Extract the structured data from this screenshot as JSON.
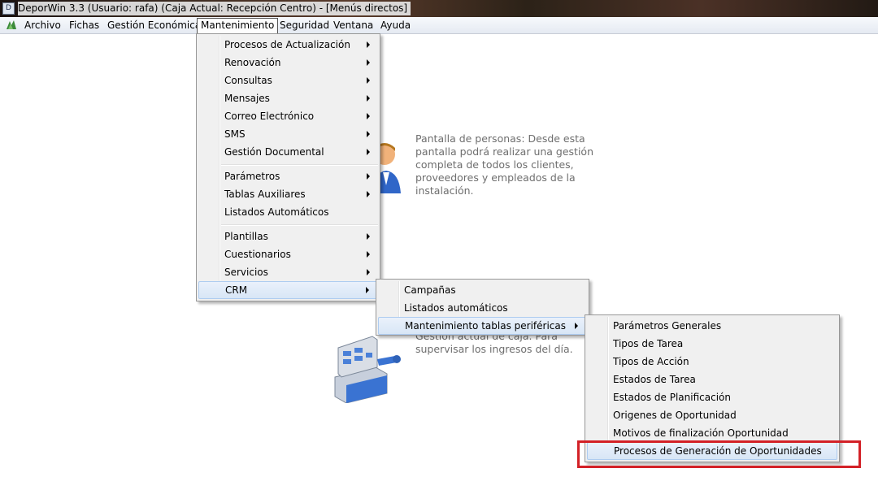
{
  "window": {
    "title": "DeporWin 3.3  (Usuario: rafa)  (Caja Actual: Recepción Centro) - [Menús directos]",
    "app_icon_letter": "D"
  },
  "menubar": {
    "items": [
      "Archivo",
      "Fichas",
      "Gestión Económica",
      "Mantenimiento",
      "Seguridad",
      "Ventana",
      "Ayuda"
    ],
    "active": "Mantenimiento"
  },
  "background": {
    "personas_text": [
      "Pantalla de personas: Desde esta",
      "pantalla podrá realizar una gestión",
      "completa de todos los clientes,",
      "proveedores y empleados de la",
      "instalación."
    ],
    "caja_text": [
      "Gestión actual de caja. Para",
      "supervisar los ingresos del día."
    ]
  },
  "menu_mantenimiento": {
    "group1": [
      {
        "label": "Procesos de Actualización",
        "submenu": true
      },
      {
        "label": "Renovación",
        "submenu": true
      },
      {
        "label": "Consultas",
        "submenu": true
      },
      {
        "label": "Mensajes",
        "submenu": true
      },
      {
        "label": "Correo Electrónico",
        "submenu": true
      },
      {
        "label": "SMS",
        "submenu": true
      },
      {
        "label": "Gestión Documental",
        "submenu": true
      }
    ],
    "group2": [
      {
        "label": "Parámetros",
        "submenu": true
      },
      {
        "label": "Tablas Auxiliares",
        "submenu": true
      },
      {
        "label": "Listados Automáticos",
        "submenu": false
      }
    ],
    "group3": [
      {
        "label": "Plantillas",
        "submenu": true
      },
      {
        "label": "Cuestionarios",
        "submenu": true
      },
      {
        "label": "Servicios",
        "submenu": true
      },
      {
        "label": "CRM",
        "submenu": true,
        "highlighted": true
      }
    ]
  },
  "menu_crm": {
    "items": [
      {
        "label": "Campañas",
        "submenu": false
      },
      {
        "label": "Listados automáticos",
        "submenu": false
      },
      {
        "label": "Mantenimiento tablas periféricas",
        "submenu": true,
        "highlighted": true
      }
    ]
  },
  "menu_tablas": {
    "items": [
      {
        "label": "Parámetros Generales"
      },
      {
        "label": "Tipos de Tarea"
      },
      {
        "label": "Tipos de Acción"
      },
      {
        "label": "Estados de Tarea"
      },
      {
        "label": "Estados de Planificación"
      },
      {
        "label": "Origenes de Oportunidad"
      },
      {
        "label": "Motivos de finalización Oportunidad"
      },
      {
        "label": "Procesos de Generación de Oportunidades",
        "highlighted": true
      }
    ]
  },
  "colors": {
    "highlight_box": "#d32127",
    "menu_bg": "#f0f0f0",
    "menu_hover": "#d8e6f6"
  }
}
